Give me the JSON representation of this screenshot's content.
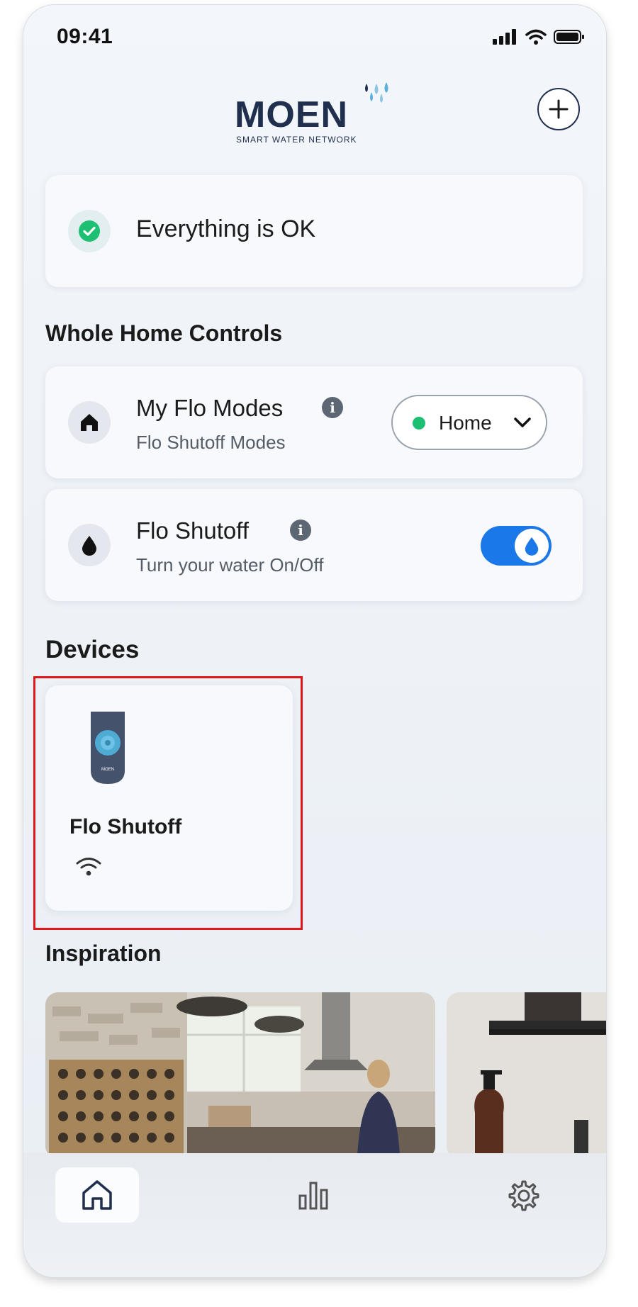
{
  "status_bar": {
    "time": "09:41"
  },
  "header": {
    "brand": "MOEN",
    "brand_sub": "SMART WATER NETWORK"
  },
  "status_card": {
    "text": "Everything is OK",
    "color": "#1dbf73"
  },
  "whole_home": {
    "title": "Whole Home Controls",
    "modes": {
      "title": "My Flo Modes",
      "subtitle": "Flo Shutoff Modes",
      "selected_mode": "Home"
    },
    "shutoff": {
      "title": "Flo Shutoff",
      "subtitle": "Turn your water On/Off",
      "toggle_on": true,
      "accent": "#1b78e8"
    }
  },
  "devices": {
    "title": "Devices",
    "items": [
      {
        "name": "Flo Shutoff",
        "device_label": "MOEN",
        "connection": "wifi-icon"
      }
    ]
  },
  "inspiration": {
    "title": "Inspiration"
  },
  "tabbar": {
    "items": [
      "home-icon",
      "stats-icon",
      "gear-icon"
    ],
    "active": "home-icon"
  }
}
